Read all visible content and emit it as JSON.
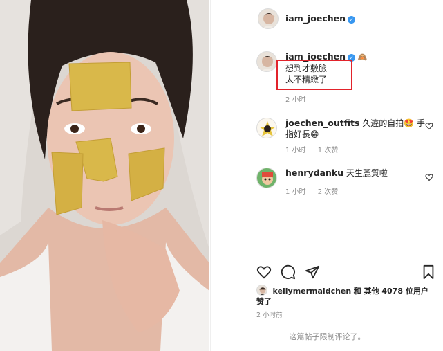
{
  "post": {
    "author": "iam_joechen",
    "verified": true
  },
  "comments": [
    {
      "user": "iam_joechen",
      "text_line1": "想到才敷臉",
      "text_line2": "太不精緻了",
      "time": "2 小时",
      "emoji": "🙈"
    },
    {
      "user": "joechen_outfits",
      "text": "久違的自拍🤩 手指好長😁",
      "time": "1 小时",
      "likes": "1 次赞"
    },
    {
      "user": "henrydanku",
      "text": "天生麗質啦",
      "time": "1 小时",
      "likes": "2 次赞"
    }
  ],
  "likes_line": {
    "user": "kellymermaidchen",
    "text": "和 其他 4078 位用户",
    "text2": "赞了"
  },
  "time_ago": "2 小时前",
  "footer_text": "这篇帖子限制评论了。",
  "colors": {
    "verified": "#3897f0",
    "highlight": "#e2232b",
    "muted": "#8e8e8e",
    "gold": "#d9b84a"
  },
  "icons": {
    "like": "heart-icon",
    "comment": "comment-icon",
    "share": "share-icon",
    "save": "bookmark-icon"
  }
}
